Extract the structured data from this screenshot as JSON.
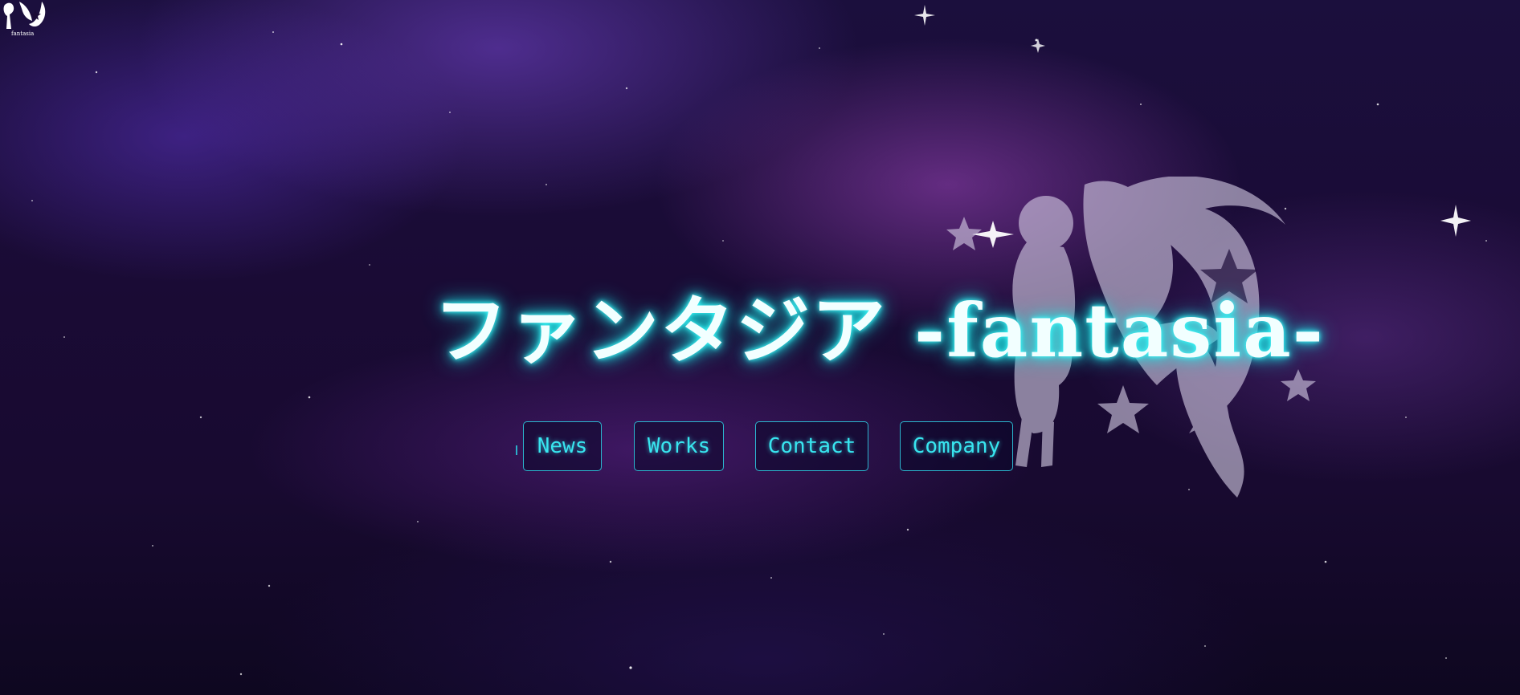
{
  "brand": {
    "logo_text": "fantasia"
  },
  "hero": {
    "title": "ファンタジア -fantasia-"
  },
  "nav": {
    "items": [
      {
        "label": "News"
      },
      {
        "label": "Works"
      },
      {
        "label": "Contact"
      },
      {
        "label": "Company"
      }
    ]
  },
  "colors": {
    "accent": "#38e6f0",
    "button_border": "#2bb7cf",
    "title_glow": "#22eeee",
    "background": "#1a0b35"
  }
}
